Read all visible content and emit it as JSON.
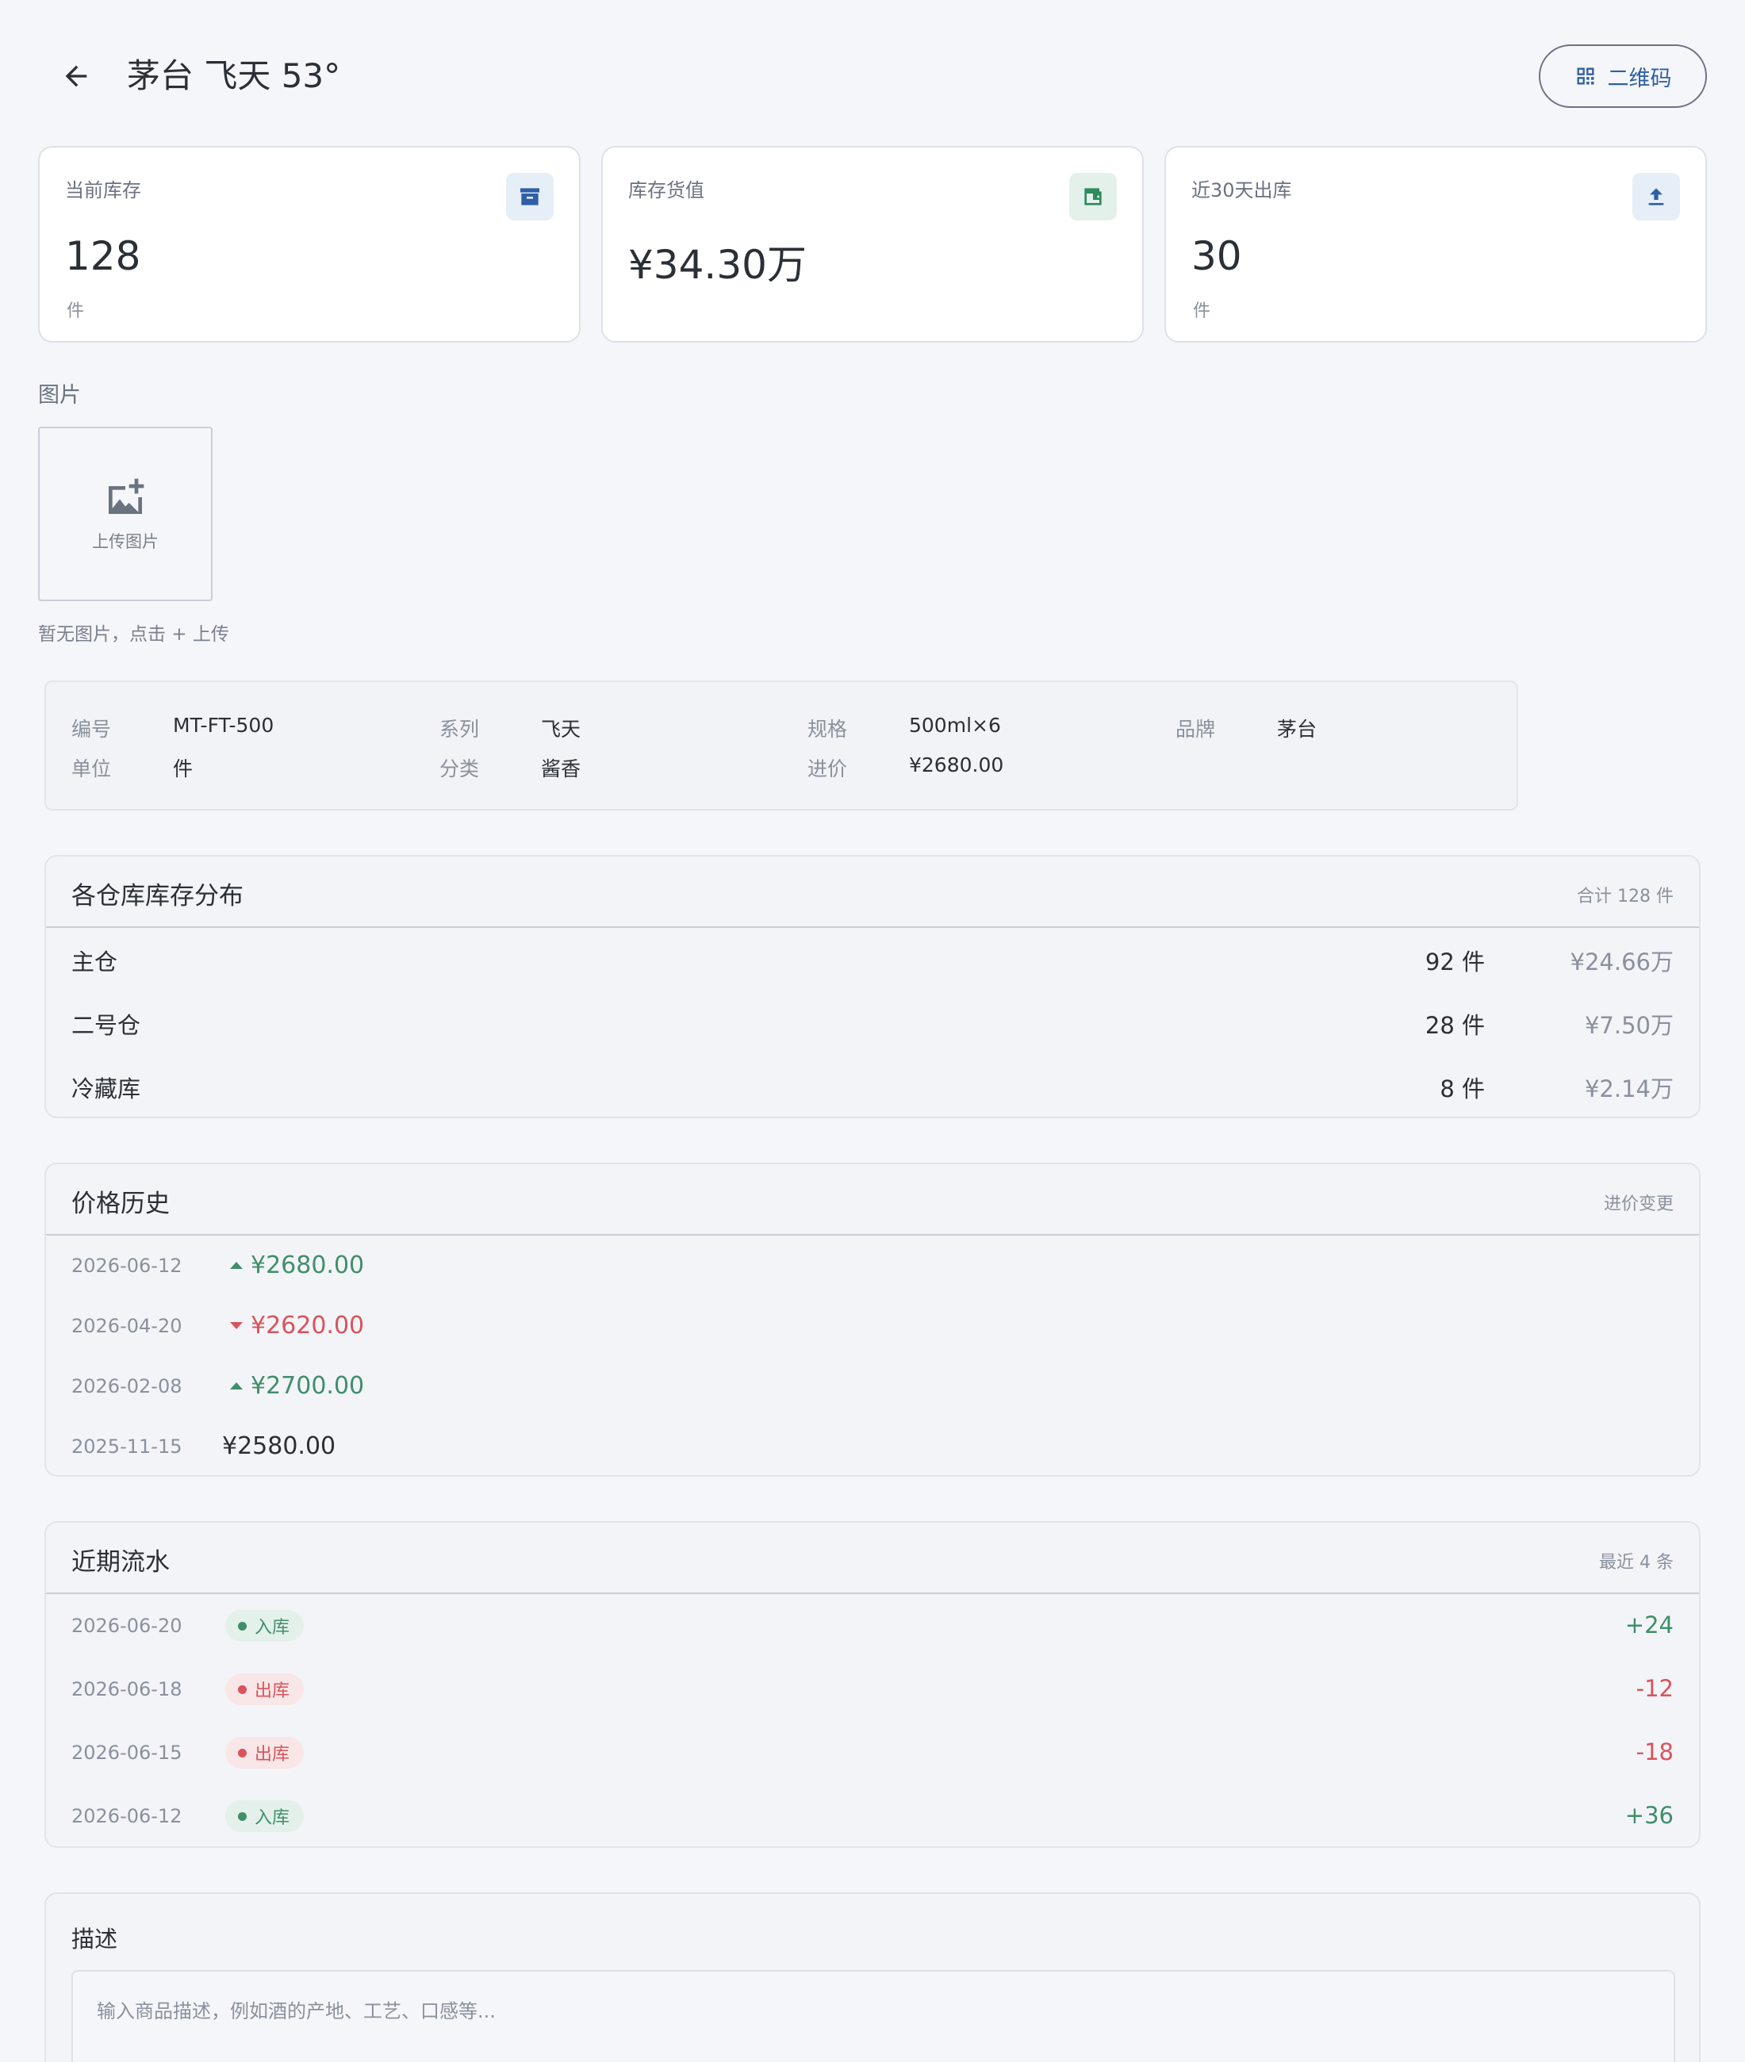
{
  "header": {
    "title": "茅台 飞天 53°",
    "qr_label": "二维码"
  },
  "stats": [
    {
      "label": "当前库存",
      "value": "128",
      "unit": "件",
      "icon": "archive-icon",
      "icon_color": "#2f5fa6",
      "icon_bg": "#e6eef8"
    },
    {
      "label": "库存货值",
      "value": "¥34.30万",
      "unit": "",
      "icon": "wallet-icon",
      "icon_color": "#2f8a5e",
      "icon_bg": "#e3f1ea"
    },
    {
      "label": "近30天出库",
      "value": "30",
      "unit": "件",
      "icon": "upload-icon",
      "icon_color": "#2f5fa6",
      "icon_bg": "#e6eef8"
    }
  ],
  "images": {
    "section_label": "图片",
    "upload_label": "上传图片",
    "hint": "暂无图片，点击 + 上传"
  },
  "info": {
    "code_key": "编号",
    "code_val": "MT-FT-500",
    "series_key": "系列",
    "series_val": "飞天",
    "spec_key": "规格",
    "spec_val": "500ml×6",
    "brand_key": "品牌",
    "brand_val": "茅台",
    "unit_key": "单位",
    "unit_val": "件",
    "category_key": "分类",
    "category_val": "酱香",
    "cost_key": "进价",
    "cost_val": "¥2680.00"
  },
  "warehouses": {
    "title": "各仓库库存分布",
    "note": "合计 128 件",
    "rows": [
      {
        "name": "主仓",
        "qty": "92 件",
        "value": "¥24.66万"
      },
      {
        "name": "二号仓",
        "qty": "28 件",
        "value": "¥7.50万"
      },
      {
        "name": "冷藏库",
        "qty": "8 件",
        "value": "¥2.14万"
      }
    ]
  },
  "price_history": {
    "title": "价格历史",
    "note": "进价变更",
    "rows": [
      {
        "date": "2026-06-12",
        "price": "¥2680.00",
        "trend": "up"
      },
      {
        "date": "2026-04-20",
        "price": "¥2620.00",
        "trend": "down"
      },
      {
        "date": "2026-02-08",
        "price": "¥2700.00",
        "trend": "up"
      },
      {
        "date": "2025-11-15",
        "price": "¥2580.00",
        "trend": "none"
      }
    ]
  },
  "flows": {
    "title": "近期流水",
    "note": "最近 4 条",
    "rows": [
      {
        "date": "2026-06-20",
        "type": "入库",
        "amount": "+24"
      },
      {
        "date": "2026-06-18",
        "type": "出库",
        "amount": "-12"
      },
      {
        "date": "2026-06-15",
        "type": "出库",
        "amount": "-18"
      },
      {
        "date": "2026-06-12",
        "type": "入库",
        "amount": "+36"
      }
    ]
  },
  "description": {
    "title": "描述",
    "placeholder": "输入商品描述，例如酒的产地、工艺、口感等..."
  },
  "colors": {
    "accent": "#2f5fa6",
    "up": "#3f8f6a",
    "down": "#d9535b"
  }
}
